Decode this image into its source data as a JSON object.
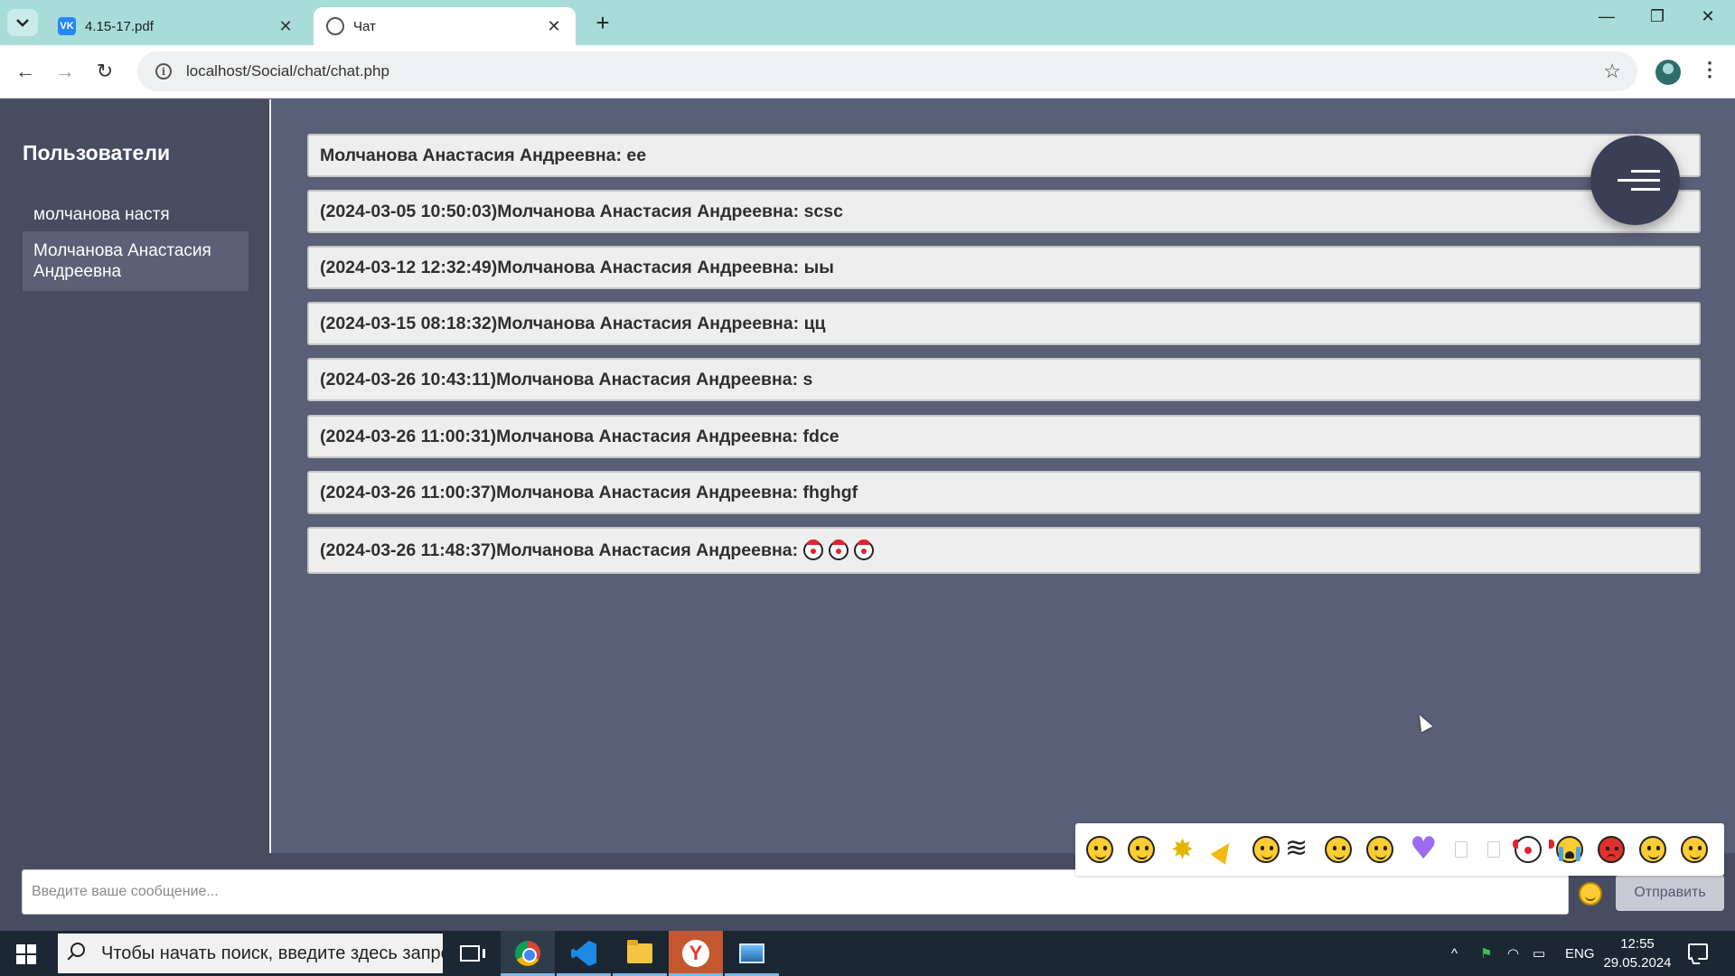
{
  "browser": {
    "tabs": [
      {
        "title": "4.15-17.pdf",
        "favicon": "vk-icon",
        "active": false
      },
      {
        "title": "Чат",
        "favicon": "globe-icon",
        "active": true
      }
    ],
    "url": "localhost/Social/chat/chat.php"
  },
  "sidebar": {
    "title": "Пользователи",
    "users": [
      {
        "name": "молчанова настя",
        "selected": false
      },
      {
        "name": "Молчанова Анастасия Андреевна",
        "selected": true
      }
    ]
  },
  "chat": {
    "messages": [
      {
        "text": "Молчанова Анастасия Андреевна: ee"
      },
      {
        "text": "(2024-03-05 10:50:03)Молчанова Анастасия Андреевна: scsc"
      },
      {
        "text": "(2024-03-12 12:32:49)Молчанова Анастасия Андреевна: ыы"
      },
      {
        "text": "(2024-03-15 08:18:32)Молчанова Анастасия Андреевна: цц"
      },
      {
        "text": "(2024-03-26 10:43:11)Молчанова Анастасия Андреевна: s"
      },
      {
        "text": "(2024-03-26 11:00:31)Молчанова Анастасия Андреевна: fdce"
      },
      {
        "text": "(2024-03-26 11:00:37)Молчанова Анастасия Андреевна: fhghgf"
      },
      {
        "text": "(2024-03-26 11:48:37)Молчанова Анастасия Андреевна: ",
        "emoji": [
          "clown-icon",
          "clown-icon",
          "clown-icon"
        ]
      }
    ],
    "input_placeholder": "Введите ваше сообщение...",
    "send_label": "Отправить",
    "emoji_picker": [
      "smile",
      "blush",
      "sparkle",
      "party-popper",
      "no-mouth",
      "waves",
      "tongue",
      "laugh",
      "purple-heart",
      "blank",
      "blank",
      "clown",
      "crying",
      "angry",
      "disappointed",
      "monocle"
    ]
  },
  "taskbar": {
    "search_placeholder": "Чтобы начать поиск, введите здесь запрос",
    "language": "ENG",
    "time": "12:55",
    "date": "29.05.2024"
  }
}
